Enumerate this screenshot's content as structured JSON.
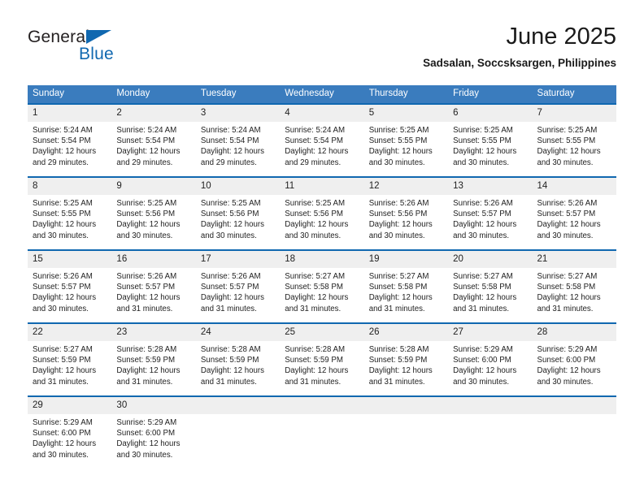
{
  "brand": {
    "name_part1": "General",
    "name_part2": "Blue",
    "flag_icon": "blue-triangle-flag-icon",
    "accent_color": "#1068b0"
  },
  "header": {
    "month_title": "June 2025",
    "location": "Sadsalan, Soccsksargen, Philippines"
  },
  "theme": {
    "header_bg": "#3a7cbe",
    "row_border": "#1068b0",
    "daynum_bg": "#efefef"
  },
  "calendar": {
    "weekday_headers": [
      "Sunday",
      "Monday",
      "Tuesday",
      "Wednesday",
      "Thursday",
      "Friday",
      "Saturday"
    ],
    "weeks": [
      [
        {
          "day": "1",
          "sunrise": "Sunrise: 5:24 AM",
          "sunset": "Sunset: 5:54 PM",
          "daylight": "Daylight: 12 hours and 29 minutes."
        },
        {
          "day": "2",
          "sunrise": "Sunrise: 5:24 AM",
          "sunset": "Sunset: 5:54 PM",
          "daylight": "Daylight: 12 hours and 29 minutes."
        },
        {
          "day": "3",
          "sunrise": "Sunrise: 5:24 AM",
          "sunset": "Sunset: 5:54 PM",
          "daylight": "Daylight: 12 hours and 29 minutes."
        },
        {
          "day": "4",
          "sunrise": "Sunrise: 5:24 AM",
          "sunset": "Sunset: 5:54 PM",
          "daylight": "Daylight: 12 hours and 29 minutes."
        },
        {
          "day": "5",
          "sunrise": "Sunrise: 5:25 AM",
          "sunset": "Sunset: 5:55 PM",
          "daylight": "Daylight: 12 hours and 30 minutes."
        },
        {
          "day": "6",
          "sunrise": "Sunrise: 5:25 AM",
          "sunset": "Sunset: 5:55 PM",
          "daylight": "Daylight: 12 hours and 30 minutes."
        },
        {
          "day": "7",
          "sunrise": "Sunrise: 5:25 AM",
          "sunset": "Sunset: 5:55 PM",
          "daylight": "Daylight: 12 hours and 30 minutes."
        }
      ],
      [
        {
          "day": "8",
          "sunrise": "Sunrise: 5:25 AM",
          "sunset": "Sunset: 5:55 PM",
          "daylight": "Daylight: 12 hours and 30 minutes."
        },
        {
          "day": "9",
          "sunrise": "Sunrise: 5:25 AM",
          "sunset": "Sunset: 5:56 PM",
          "daylight": "Daylight: 12 hours and 30 minutes."
        },
        {
          "day": "10",
          "sunrise": "Sunrise: 5:25 AM",
          "sunset": "Sunset: 5:56 PM",
          "daylight": "Daylight: 12 hours and 30 minutes."
        },
        {
          "day": "11",
          "sunrise": "Sunrise: 5:25 AM",
          "sunset": "Sunset: 5:56 PM",
          "daylight": "Daylight: 12 hours and 30 minutes."
        },
        {
          "day": "12",
          "sunrise": "Sunrise: 5:26 AM",
          "sunset": "Sunset: 5:56 PM",
          "daylight": "Daylight: 12 hours and 30 minutes."
        },
        {
          "day": "13",
          "sunrise": "Sunrise: 5:26 AM",
          "sunset": "Sunset: 5:57 PM",
          "daylight": "Daylight: 12 hours and 30 minutes."
        },
        {
          "day": "14",
          "sunrise": "Sunrise: 5:26 AM",
          "sunset": "Sunset: 5:57 PM",
          "daylight": "Daylight: 12 hours and 30 minutes."
        }
      ],
      [
        {
          "day": "15",
          "sunrise": "Sunrise: 5:26 AM",
          "sunset": "Sunset: 5:57 PM",
          "daylight": "Daylight: 12 hours and 30 minutes."
        },
        {
          "day": "16",
          "sunrise": "Sunrise: 5:26 AM",
          "sunset": "Sunset: 5:57 PM",
          "daylight": "Daylight: 12 hours and 31 minutes."
        },
        {
          "day": "17",
          "sunrise": "Sunrise: 5:26 AM",
          "sunset": "Sunset: 5:57 PM",
          "daylight": "Daylight: 12 hours and 31 minutes."
        },
        {
          "day": "18",
          "sunrise": "Sunrise: 5:27 AM",
          "sunset": "Sunset: 5:58 PM",
          "daylight": "Daylight: 12 hours and 31 minutes."
        },
        {
          "day": "19",
          "sunrise": "Sunrise: 5:27 AM",
          "sunset": "Sunset: 5:58 PM",
          "daylight": "Daylight: 12 hours and 31 minutes."
        },
        {
          "day": "20",
          "sunrise": "Sunrise: 5:27 AM",
          "sunset": "Sunset: 5:58 PM",
          "daylight": "Daylight: 12 hours and 31 minutes."
        },
        {
          "day": "21",
          "sunrise": "Sunrise: 5:27 AM",
          "sunset": "Sunset: 5:58 PM",
          "daylight": "Daylight: 12 hours and 31 minutes."
        }
      ],
      [
        {
          "day": "22",
          "sunrise": "Sunrise: 5:27 AM",
          "sunset": "Sunset: 5:59 PM",
          "daylight": "Daylight: 12 hours and 31 minutes."
        },
        {
          "day": "23",
          "sunrise": "Sunrise: 5:28 AM",
          "sunset": "Sunset: 5:59 PM",
          "daylight": "Daylight: 12 hours and 31 minutes."
        },
        {
          "day": "24",
          "sunrise": "Sunrise: 5:28 AM",
          "sunset": "Sunset: 5:59 PM",
          "daylight": "Daylight: 12 hours and 31 minutes."
        },
        {
          "day": "25",
          "sunrise": "Sunrise: 5:28 AM",
          "sunset": "Sunset: 5:59 PM",
          "daylight": "Daylight: 12 hours and 31 minutes."
        },
        {
          "day": "26",
          "sunrise": "Sunrise: 5:28 AM",
          "sunset": "Sunset: 5:59 PM",
          "daylight": "Daylight: 12 hours and 31 minutes."
        },
        {
          "day": "27",
          "sunrise": "Sunrise: 5:29 AM",
          "sunset": "Sunset: 6:00 PM",
          "daylight": "Daylight: 12 hours and 30 minutes."
        },
        {
          "day": "28",
          "sunrise": "Sunrise: 5:29 AM",
          "sunset": "Sunset: 6:00 PM",
          "daylight": "Daylight: 12 hours and 30 minutes."
        }
      ],
      [
        {
          "day": "29",
          "sunrise": "Sunrise: 5:29 AM",
          "sunset": "Sunset: 6:00 PM",
          "daylight": "Daylight: 12 hours and 30 minutes."
        },
        {
          "day": "30",
          "sunrise": "Sunrise: 5:29 AM",
          "sunset": "Sunset: 6:00 PM",
          "daylight": "Daylight: 12 hours and 30 minutes."
        },
        {
          "day": "",
          "sunrise": "",
          "sunset": "",
          "daylight": ""
        },
        {
          "day": "",
          "sunrise": "",
          "sunset": "",
          "daylight": ""
        },
        {
          "day": "",
          "sunrise": "",
          "sunset": "",
          "daylight": ""
        },
        {
          "day": "",
          "sunrise": "",
          "sunset": "",
          "daylight": ""
        },
        {
          "day": "",
          "sunrise": "",
          "sunset": "",
          "daylight": ""
        }
      ]
    ]
  }
}
